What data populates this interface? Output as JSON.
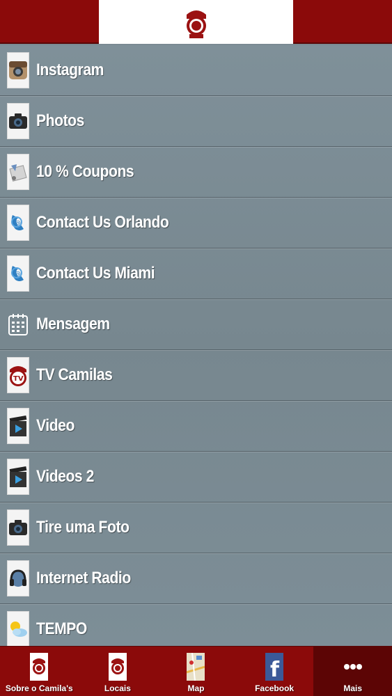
{
  "menu": {
    "items": [
      {
        "label": "Instagram",
        "icon": "instagram-icon"
      },
      {
        "label": "Photos",
        "icon": "camera-icon"
      },
      {
        "label": "10 % Coupons",
        "icon": "coupons-icon"
      },
      {
        "label": "Contact Us Orlando",
        "icon": "contact-phone-icon"
      },
      {
        "label": "Contact Us Miami",
        "icon": "contact-phone-icon"
      },
      {
        "label": "Mensagem",
        "icon": "calendar-icon"
      },
      {
        "label": "TV Camilas",
        "icon": "tv-logo-icon"
      },
      {
        "label": "Video",
        "icon": "video-clapper-icon"
      },
      {
        "label": "Videos 2",
        "icon": "video-clapper-icon"
      },
      {
        "label": "Tire uma Foto",
        "icon": "camera-icon"
      },
      {
        "label": "Internet Radio",
        "icon": "headphones-icon"
      },
      {
        "label": "TEMPO",
        "icon": "weather-icon"
      }
    ]
  },
  "tabs": [
    {
      "label": "Sobre o Camila's",
      "icon": "camilas-logo-icon"
    },
    {
      "label": "Locais",
      "icon": "camilas-logo-icon"
    },
    {
      "label": "Map",
      "icon": "map-icon"
    },
    {
      "label": "Facebook",
      "icon": "facebook-icon"
    },
    {
      "label": "Mais",
      "icon": "more-dots-icon",
      "active": true
    }
  ],
  "colors": {
    "header": "#8b0a0a",
    "tab_active": "#5c0505",
    "list_bg": "#7a8a93"
  }
}
